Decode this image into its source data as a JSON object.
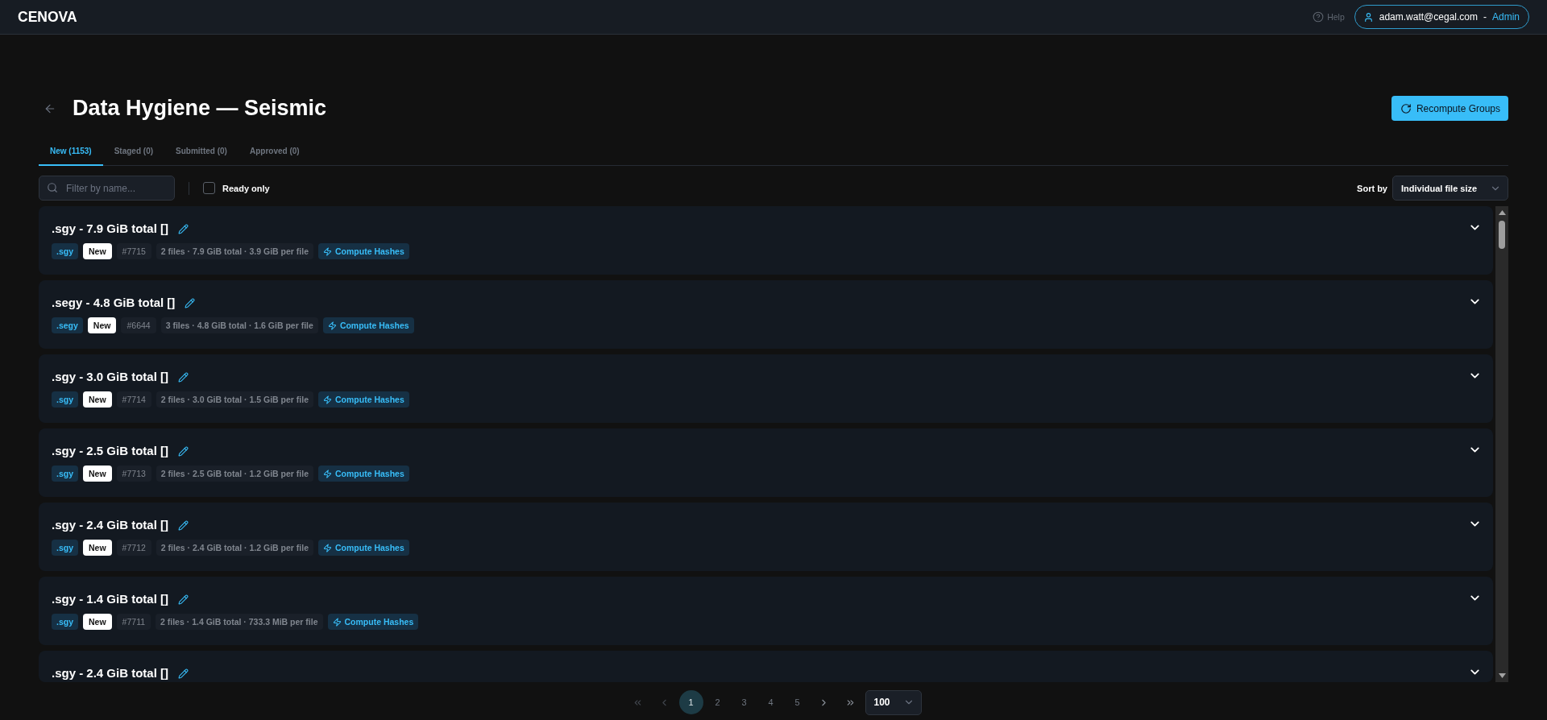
{
  "header": {
    "logo": "CENOVA",
    "help": "Help",
    "user": {
      "email": "adam.watt@cegal.com",
      "separator": "-",
      "role": "Admin"
    }
  },
  "page": {
    "title": "Data Hygiene — Seismic",
    "action": "Recompute Groups"
  },
  "tabs": [
    {
      "label": "New (1153)",
      "selected": true
    },
    {
      "label": "Staged (0)",
      "selected": false
    },
    {
      "label": "Submitted (0)",
      "selected": false
    },
    {
      "label": "Approved (0)",
      "selected": false
    }
  ],
  "filters": {
    "search": {
      "placeholder": "Filter by name..."
    },
    "ready_only": {
      "label": "Ready only",
      "checked": false
    },
    "sort": {
      "label": "Sort by",
      "value": "Individual file size"
    }
  },
  "groups": [
    {
      "title": ".sgy - 7.9 GiB total []",
      "extension": ".sgy",
      "status": "New",
      "number": "#7715",
      "summary": "2 files · 7.9 GiB total · 3.9 GiB per file",
      "action": "Compute Hashes"
    },
    {
      "title": ".segy - 4.8 GiB total []",
      "extension": ".segy",
      "status": "New",
      "number": "#6644",
      "summary": "3 files · 4.8 GiB total · 1.6 GiB per file",
      "action": "Compute Hashes"
    },
    {
      "title": ".sgy - 3.0 GiB total []",
      "extension": ".sgy",
      "status": "New",
      "number": "#7714",
      "summary": "2 files · 3.0 GiB total · 1.5 GiB per file",
      "action": "Compute Hashes"
    },
    {
      "title": ".sgy - 2.5 GiB total []",
      "extension": ".sgy",
      "status": "New",
      "number": "#7713",
      "summary": "2 files · 2.5 GiB total · 1.2 GiB per file",
      "action": "Compute Hashes"
    },
    {
      "title": ".sgy - 2.4 GiB total []",
      "extension": ".sgy",
      "status": "New",
      "number": "#7712",
      "summary": "2 files · 2.4 GiB total · 1.2 GiB per file",
      "action": "Compute Hashes"
    },
    {
      "title": ".sgy - 1.4 GiB total []",
      "extension": ".sgy",
      "status": "New",
      "number": "#7711",
      "summary": "2 files · 1.4 GiB total · 733.3 MiB per file",
      "action": "Compute Hashes"
    },
    {
      "title": ".sgy - 2.4 GiB total []"
    }
  ],
  "pagination": {
    "first": {
      "disabled": true
    },
    "previous": {
      "disabled": true
    },
    "pages": [
      {
        "label": "1",
        "selected": true
      },
      {
        "label": "2",
        "selected": false
      },
      {
        "label": "3",
        "selected": false
      },
      {
        "label": "4",
        "selected": false
      },
      {
        "label": "5",
        "selected": false
      }
    ],
    "next": {
      "disabled": false
    },
    "last": {
      "disabled": false
    },
    "page_size": "100"
  }
}
